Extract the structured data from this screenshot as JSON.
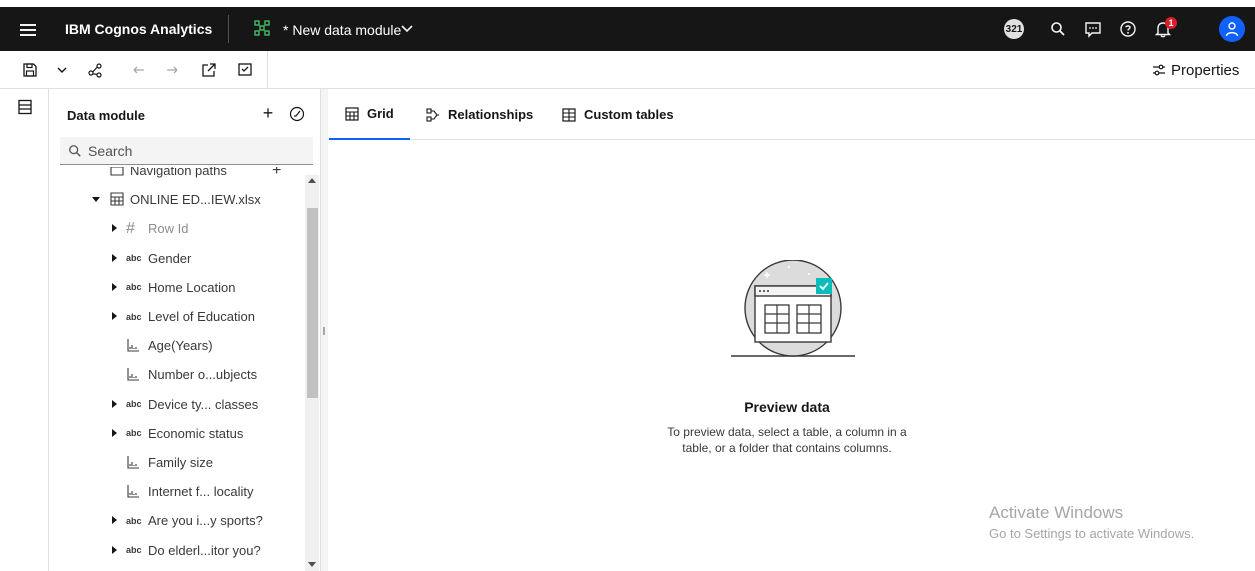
{
  "topbar": {
    "brand": "IBM Cognos Analytics",
    "module_title": "* New data module",
    "task_count": "321",
    "notification_count": "1",
    "accent": "#0f62fe"
  },
  "toolbar": {
    "properties_label": "Properties"
  },
  "panel": {
    "title": "Data module",
    "search_placeholder": "Search",
    "items": [
      {
        "label": "Navigation paths",
        "icon": "folder-icon",
        "caret": false,
        "indent": 0
      },
      {
        "label": "ONLINE ED...IEW.xlsx",
        "icon": "table-icon",
        "caret": "expanded",
        "indent": 0
      },
      {
        "label": "Row Id",
        "icon": "#",
        "caret": "collapsed",
        "indent": 1,
        "muted": true
      },
      {
        "label": "Gender",
        "icon": "abc",
        "caret": "collapsed",
        "indent": 1
      },
      {
        "label": "Home Location",
        "icon": "abc",
        "caret": "collapsed",
        "indent": 1
      },
      {
        "label": "Level of Education",
        "icon": "abc",
        "caret": "collapsed",
        "indent": 1
      },
      {
        "label": "Age(Years)",
        "icon": "measure-icon",
        "caret": false,
        "indent": 1
      },
      {
        "label": "Number o...ubjects",
        "icon": "measure-icon",
        "caret": false,
        "indent": 1
      },
      {
        "label": "Device ty... classes",
        "icon": "abc",
        "caret": "collapsed",
        "indent": 1
      },
      {
        "label": "Economic status",
        "icon": "abc",
        "caret": "collapsed",
        "indent": 1
      },
      {
        "label": "Family size",
        "icon": "measure-icon",
        "caret": false,
        "indent": 1
      },
      {
        "label": "Internet f... locality",
        "icon": "measure-icon",
        "caret": false,
        "indent": 1
      },
      {
        "label": "Are you i...y sports?",
        "icon": "abc",
        "caret": "collapsed",
        "indent": 1
      },
      {
        "label": "Do elderl...itor you?",
        "icon": "abc",
        "caret": "collapsed",
        "indent": 1
      }
    ]
  },
  "tabs": [
    {
      "label": "Grid",
      "active": true
    },
    {
      "label": "Relationships",
      "active": false
    },
    {
      "label": "Custom tables",
      "active": false
    }
  ],
  "empty_state": {
    "title": "Preview data",
    "line1": "To preview data, select a table, a column in a",
    "line2": "table, or a folder that contains columns."
  },
  "watermark": {
    "line1": "Activate Windows",
    "line2": "Go to Settings to activate Windows."
  }
}
